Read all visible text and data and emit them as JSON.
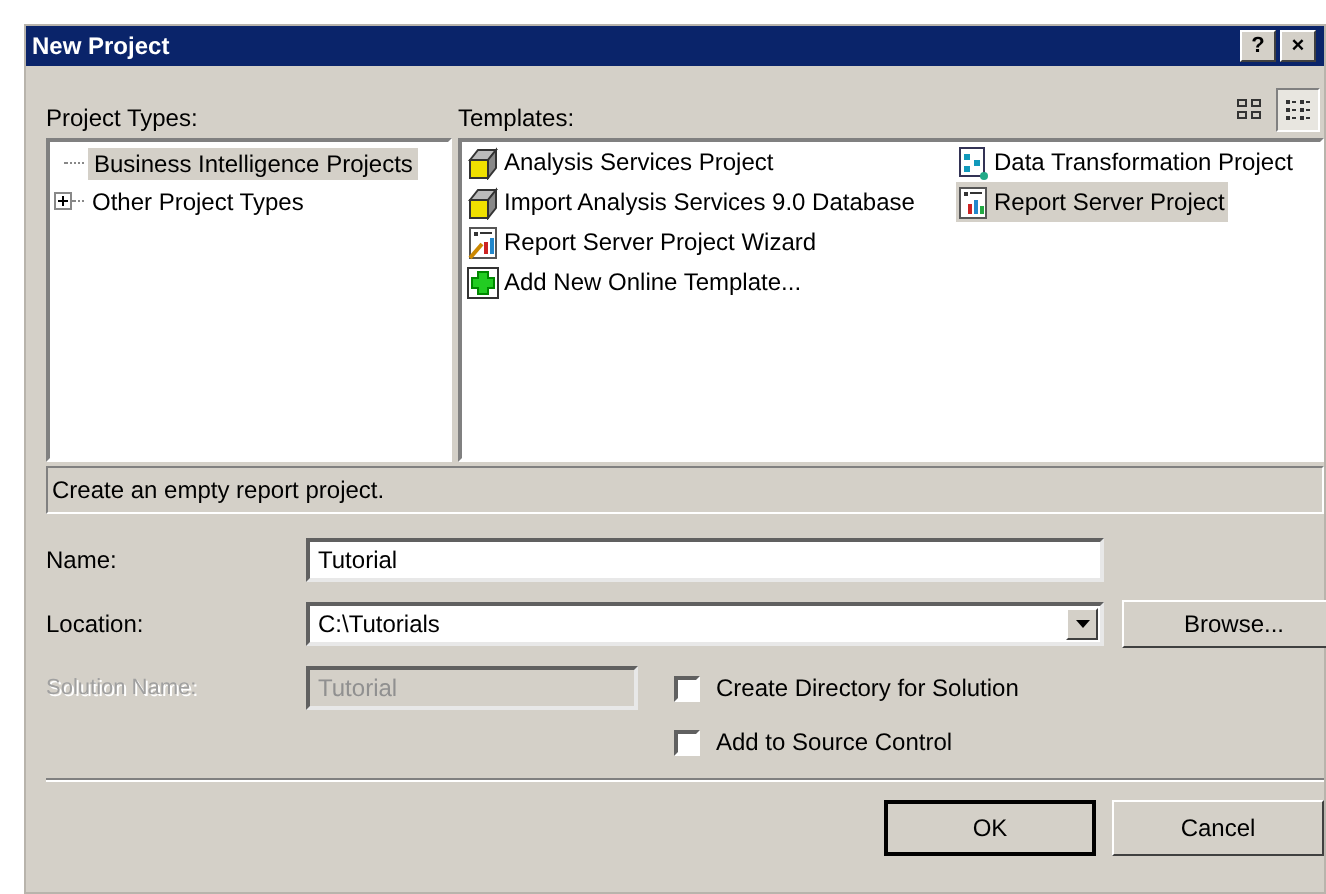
{
  "window": {
    "title": "New Project",
    "help_button": "?",
    "close_button": "×"
  },
  "project_types": {
    "label": "Project Types:",
    "items": [
      {
        "label": "Business Intelligence Projects",
        "selected": true
      },
      {
        "label": "Other Project Types",
        "selected": false,
        "expanded": false
      }
    ]
  },
  "templates": {
    "label": "Templates:",
    "views": [
      {
        "kind": "large",
        "selected": false
      },
      {
        "kind": "small",
        "selected": true
      }
    ],
    "items": [
      {
        "label": "Analysis Services Project",
        "kind": "cube",
        "selected": false
      },
      {
        "label": "Import Analysis Services 9.0 Database",
        "kind": "cube",
        "selected": false
      },
      {
        "label": "Report Server Project Wizard",
        "kind": "wizard",
        "selected": false
      },
      {
        "label": "Add New Online Template...",
        "kind": "add",
        "selected": false
      },
      {
        "label": "Data Transformation Project",
        "kind": "flow",
        "selected": false
      },
      {
        "label": "Report Server Project",
        "kind": "report",
        "selected": true
      }
    ]
  },
  "description": "Create an empty report project.",
  "fields": [
    {
      "label": "Name:",
      "kind": "text",
      "value": "Tutorial",
      "disabled": false
    },
    {
      "label": "Location:",
      "kind": "combo",
      "value": "C:\\Tutorials",
      "disabled": false,
      "button": "Browse..."
    },
    {
      "label": "Solution Name:",
      "kind": "text",
      "value": "Tutorial",
      "disabled": true,
      "checkbox": {
        "label": "Create Directory for Solution",
        "checked": false
      }
    }
  ],
  "extra_checkbox": {
    "label": "Add to Source Control",
    "checked": false
  },
  "buttons": [
    "OK",
    "Cancel"
  ]
}
